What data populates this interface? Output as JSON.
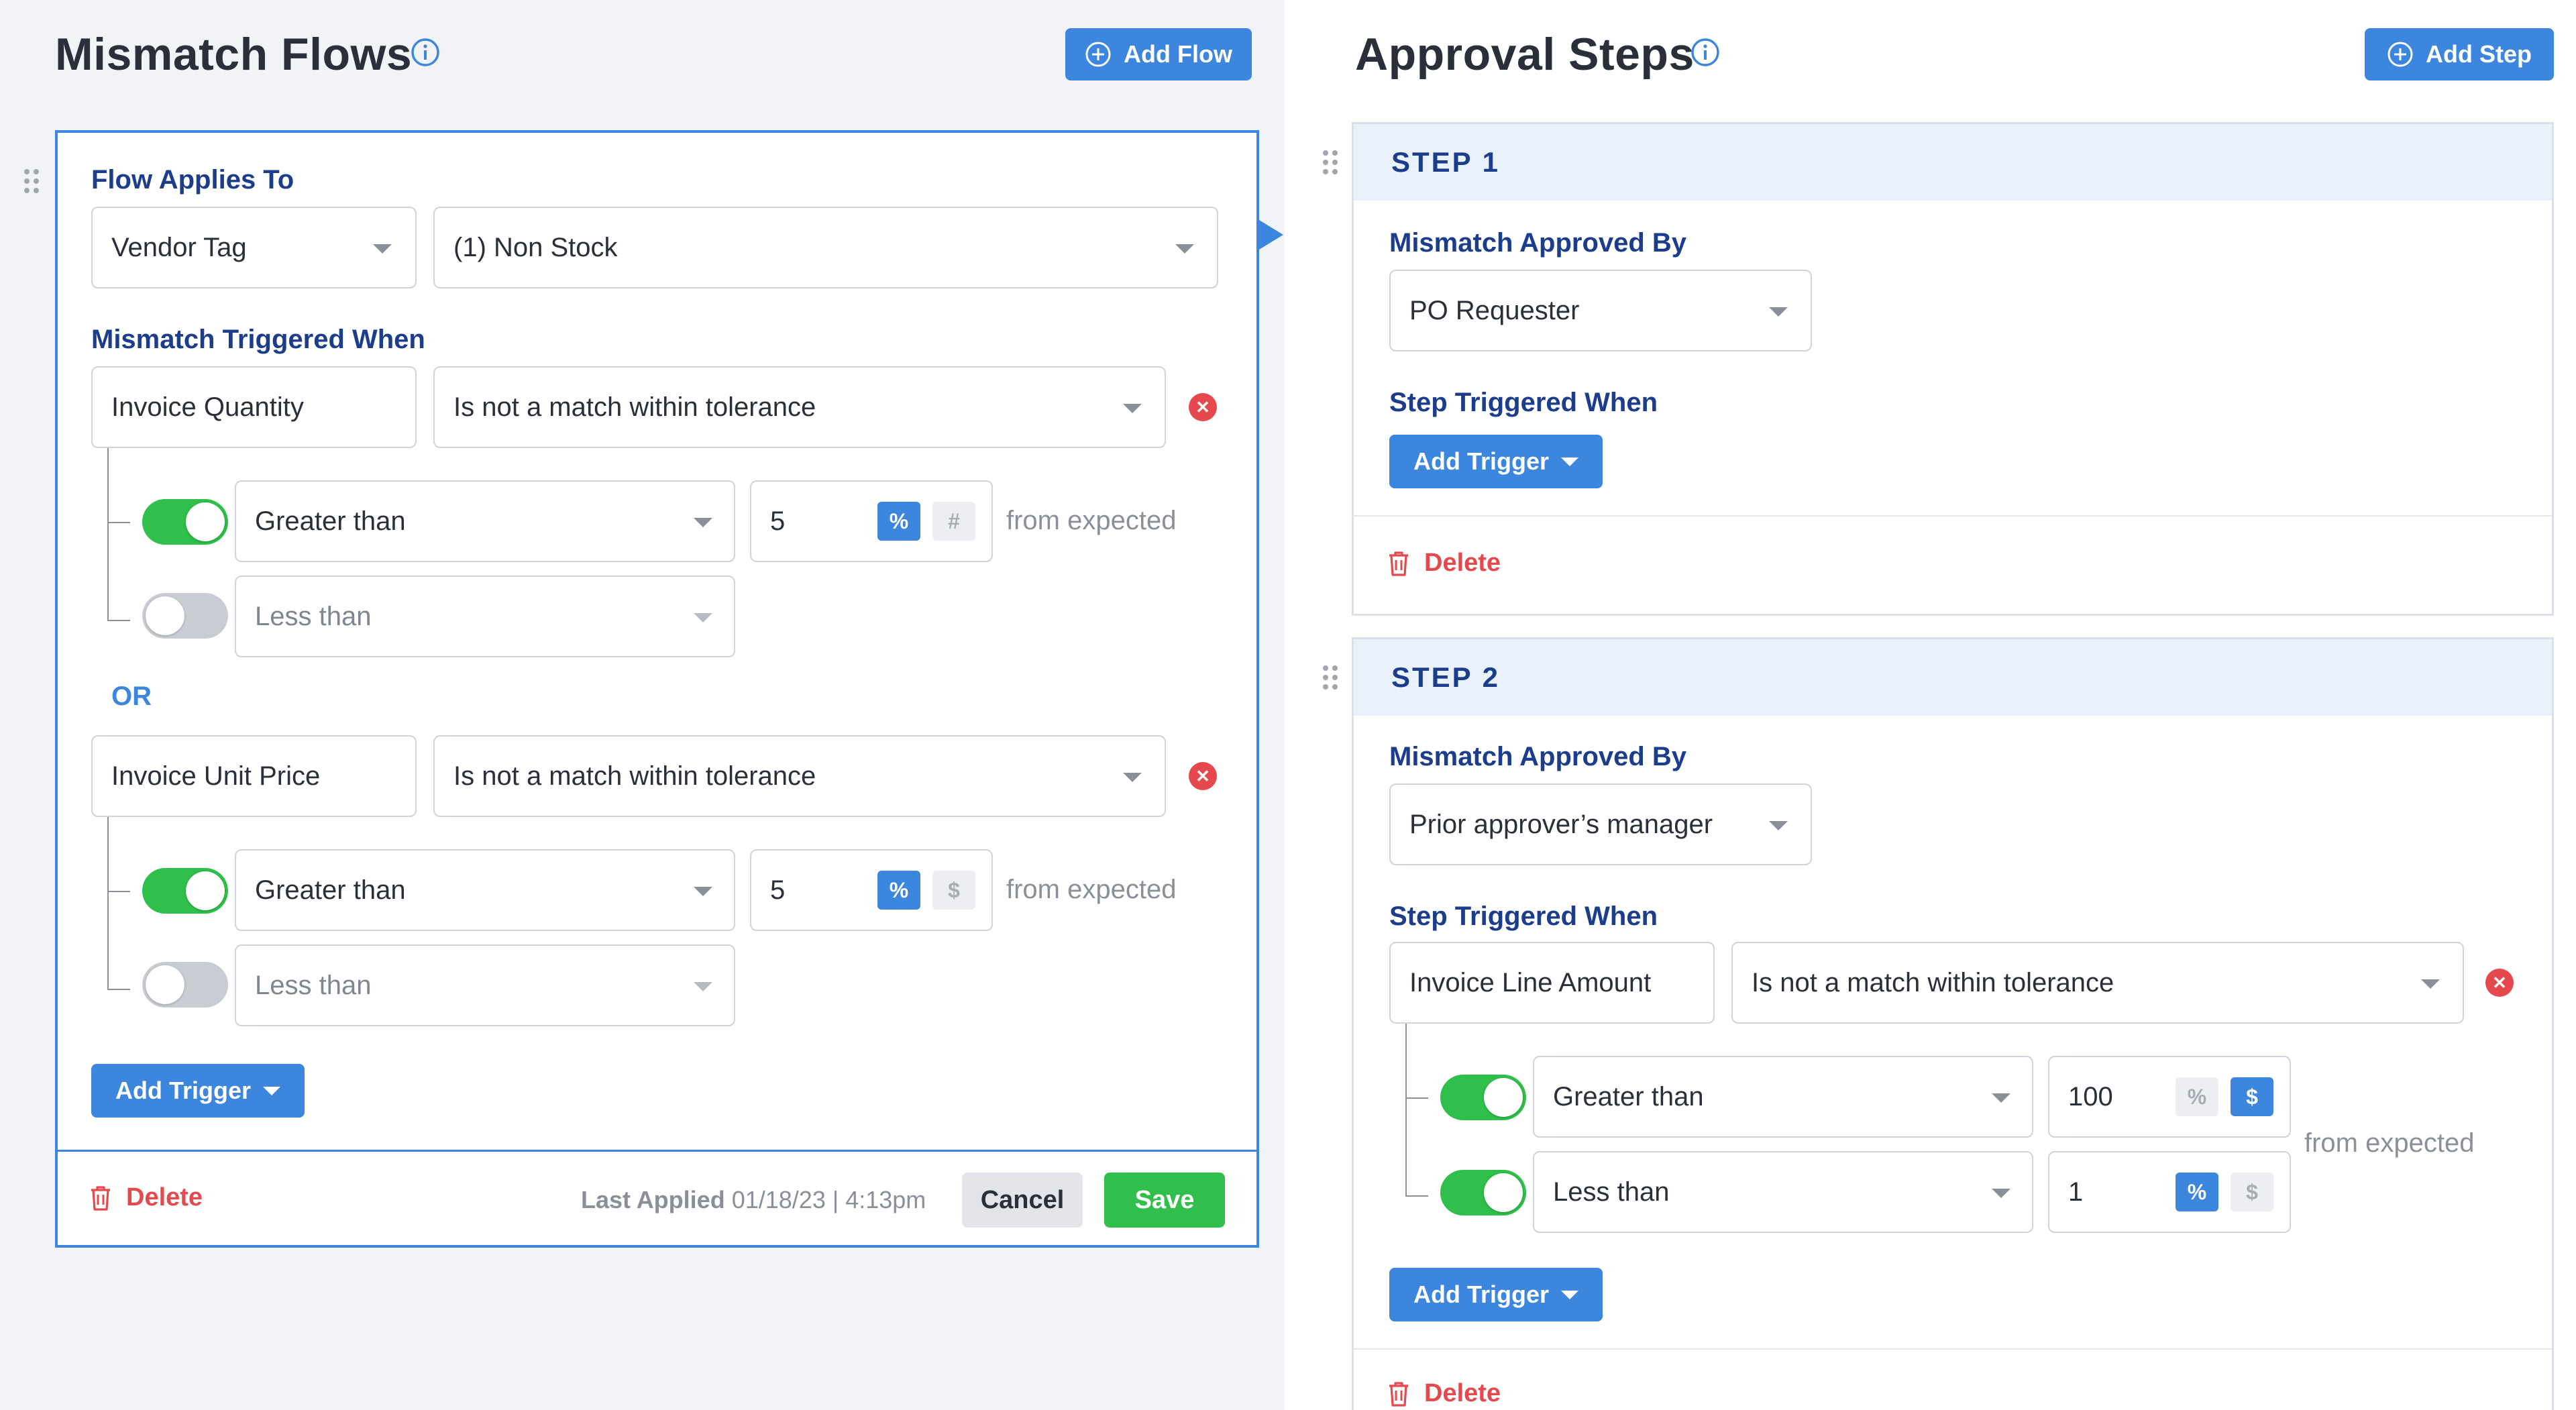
{
  "left": {
    "title": "Mismatch Flows",
    "add_flow_label": "Add Flow",
    "flow": {
      "applies_to_label": "Flow Applies To",
      "applies_to_type": "Vendor Tag",
      "applies_to_value": "(1) Non Stock",
      "triggered_when_label": "Mismatch Triggered When",
      "conditions": [
        {
          "field": "Invoice Quantity",
          "operator": "Is not a match within tolerance",
          "greater": {
            "label": "Greater than",
            "value": "5",
            "unit_a": "%",
            "unit_b": "#",
            "enabled": true
          },
          "less": {
            "label": "Less than",
            "enabled": false
          },
          "suffix": "from expected"
        },
        {
          "field": "Invoice Unit Price",
          "operator": "Is not a match within tolerance",
          "greater": {
            "label": "Greater than",
            "value": "5",
            "unit_a": "%",
            "unit_b": "$",
            "enabled": true
          },
          "less": {
            "label": "Less than",
            "enabled": false
          },
          "suffix": "from expected"
        }
      ],
      "or_label": "OR",
      "add_trigger_label": "Add Trigger",
      "delete_label": "Delete",
      "last_applied_label": "Last Applied",
      "last_applied_value": "01/18/23 | 4:13pm",
      "cancel_label": "Cancel",
      "save_label": "Save"
    }
  },
  "right": {
    "title": "Approval Steps",
    "add_step_label": "Add Step",
    "steps": [
      {
        "header": "STEP 1",
        "approved_by_label": "Mismatch Approved By",
        "approved_by": "PO Requester",
        "triggered_when_label": "Step Triggered When",
        "add_trigger_label": "Add Trigger",
        "delete_label": "Delete"
      },
      {
        "header": "STEP 2",
        "approved_by_label": "Mismatch Approved By",
        "approved_by": "Prior approver’s manager",
        "triggered_when_label": "Step Triggered When",
        "condition": {
          "field": "Invoice Line Amount",
          "operator": "Is not a match within tolerance",
          "greater": {
            "label": "Greater than",
            "value": "100",
            "unit_a": "%",
            "unit_b": "$",
            "active_unit": "$",
            "enabled": true
          },
          "less": {
            "label": "Less than",
            "value": "1",
            "unit_a": "%",
            "unit_b": "$",
            "active_unit": "%",
            "enabled": true
          },
          "suffix": "from expected"
        },
        "add_trigger_label": "Add Trigger",
        "delete_label": "Delete"
      }
    ]
  },
  "colors": {
    "primary": "#3d86de",
    "heading_blue": "#1c3d8c",
    "danger": "#e5484d",
    "success": "#2fbf4a"
  }
}
